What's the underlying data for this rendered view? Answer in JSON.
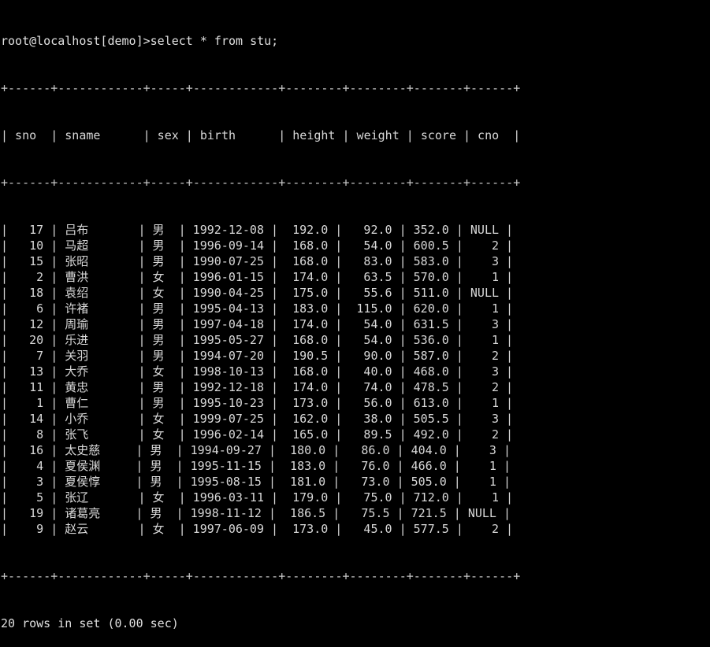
{
  "terminal": {
    "prompt": "root@localhost[demo]>",
    "command": "select * from stu;",
    "prompt_line": "root@localhost[demo]>select * from stu;",
    "status": "20 rows in set (0.00 sec)",
    "row_count": 20,
    "elapsed": "0.00 sec",
    "foreground_color": "#d8d8d8",
    "background_color": "#000000"
  },
  "table": {
    "name": "stu",
    "columns": [
      {
        "name": "sno",
        "width": 6,
        "align": "right"
      },
      {
        "name": "sname",
        "width": 12,
        "align": "left"
      },
      {
        "name": "sex",
        "width": 5,
        "align": "left"
      },
      {
        "name": "birth",
        "width": 12,
        "align": "left"
      },
      {
        "name": "height",
        "width": 8,
        "align": "right"
      },
      {
        "name": "weight",
        "width": 8,
        "align": "right"
      },
      {
        "name": "score",
        "width": 7,
        "align": "right"
      },
      {
        "name": "cno",
        "width": 6,
        "align": "right"
      }
    ],
    "separator": "+------+------------+-----+------------+--------+--------+-------+------+",
    "header_line": "| sno  | sname      | sex | birth      | height | weight | score | cno  |",
    "rows": [
      {
        "sno": "17",
        "sname": "吕布",
        "sex": "男",
        "birth": "1992-12-08",
        "height": "192.0",
        "weight": "92.0",
        "score": "352.0",
        "cno": "NULL"
      },
      {
        "sno": "10",
        "sname": "马超",
        "sex": "男",
        "birth": "1996-09-14",
        "height": "168.0",
        "weight": "54.0",
        "score": "600.5",
        "cno": "2"
      },
      {
        "sno": "15",
        "sname": "张昭",
        "sex": "男",
        "birth": "1990-07-25",
        "height": "168.0",
        "weight": "83.0",
        "score": "583.0",
        "cno": "3"
      },
      {
        "sno": "2",
        "sname": "曹洪",
        "sex": "女",
        "birth": "1996-01-15",
        "height": "174.0",
        "weight": "63.5",
        "score": "570.0",
        "cno": "1"
      },
      {
        "sno": "18",
        "sname": "袁绍",
        "sex": "女",
        "birth": "1990-04-25",
        "height": "175.0",
        "weight": "55.6",
        "score": "511.0",
        "cno": "NULL"
      },
      {
        "sno": "6",
        "sname": "许褚",
        "sex": "男",
        "birth": "1995-04-13",
        "height": "183.0",
        "weight": "115.0",
        "score": "620.0",
        "cno": "1"
      },
      {
        "sno": "12",
        "sname": "周瑜",
        "sex": "男",
        "birth": "1997-04-18",
        "height": "174.0",
        "weight": "54.0",
        "score": "631.5",
        "cno": "3"
      },
      {
        "sno": "20",
        "sname": "乐进",
        "sex": "男",
        "birth": "1995-05-27",
        "height": "168.0",
        "weight": "54.0",
        "score": "536.0",
        "cno": "1"
      },
      {
        "sno": "7",
        "sname": "关羽",
        "sex": "男",
        "birth": "1994-07-20",
        "height": "190.5",
        "weight": "90.0",
        "score": "587.0",
        "cno": "2"
      },
      {
        "sno": "13",
        "sname": "大乔",
        "sex": "女",
        "birth": "1998-10-13",
        "height": "168.0",
        "weight": "40.0",
        "score": "468.0",
        "cno": "3"
      },
      {
        "sno": "11",
        "sname": "黄忠",
        "sex": "男",
        "birth": "1992-12-18",
        "height": "174.0",
        "weight": "74.0",
        "score": "478.5",
        "cno": "2"
      },
      {
        "sno": "1",
        "sname": "曹仁",
        "sex": "男",
        "birth": "1995-10-23",
        "height": "173.0",
        "weight": "56.0",
        "score": "613.0",
        "cno": "1"
      },
      {
        "sno": "14",
        "sname": "小乔",
        "sex": "女",
        "birth": "1999-07-25",
        "height": "162.0",
        "weight": "38.0",
        "score": "505.5",
        "cno": "3"
      },
      {
        "sno": "8",
        "sname": "张飞",
        "sex": "女",
        "birth": "1996-02-14",
        "height": "165.0",
        "weight": "89.5",
        "score": "492.0",
        "cno": "2"
      },
      {
        "sno": "16",
        "sname": "太史慈",
        "sex": "男",
        "birth": "1994-09-27",
        "height": "180.0",
        "weight": "86.0",
        "score": "404.0",
        "cno": "3"
      },
      {
        "sno": "4",
        "sname": "夏侯渊",
        "sex": "男",
        "birth": "1995-11-15",
        "height": "183.0",
        "weight": "76.0",
        "score": "466.0",
        "cno": "1"
      },
      {
        "sno": "3",
        "sname": "夏侯惇",
        "sex": "男",
        "birth": "1995-08-15",
        "height": "181.0",
        "weight": "73.0",
        "score": "505.0",
        "cno": "1"
      },
      {
        "sno": "5",
        "sname": "张辽",
        "sex": "女",
        "birth": "1996-03-11",
        "height": "179.0",
        "weight": "75.0",
        "score": "712.0",
        "cno": "1"
      },
      {
        "sno": "19",
        "sname": "诸葛亮",
        "sex": "男",
        "birth": "1998-11-12",
        "height": "186.5",
        "weight": "75.5",
        "score": "721.5",
        "cno": "NULL"
      },
      {
        "sno": "9",
        "sname": "赵云",
        "sex": "女",
        "birth": "1997-06-09",
        "height": "173.0",
        "weight": "45.0",
        "score": "577.5",
        "cno": "2"
      }
    ]
  }
}
